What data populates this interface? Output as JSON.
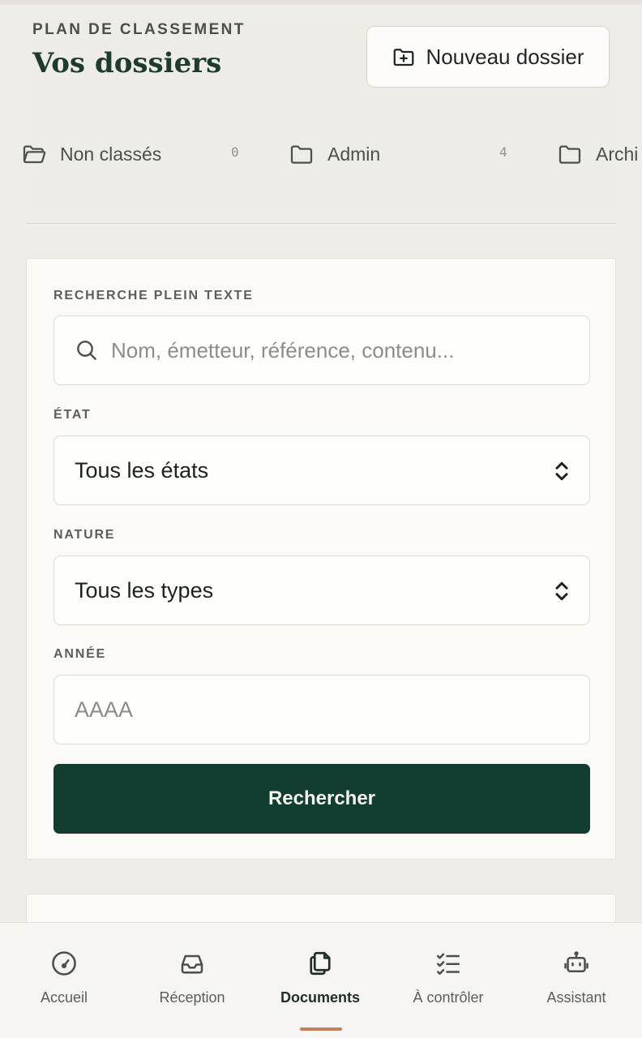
{
  "header": {
    "eyebrow": "PLAN DE CLASSEMENT",
    "title": "Vos dossiers",
    "new_folder_label": "Nouveau dossier"
  },
  "folders": [
    {
      "label": "Non classés",
      "count": "0",
      "icon": "folder-open-icon"
    },
    {
      "label": "Admin",
      "count": "4",
      "icon": "folder-icon"
    },
    {
      "label": "Archi",
      "count": "",
      "icon": "folder-icon"
    }
  ],
  "search": {
    "fulltext_label": "RECHERCHE PLEIN TEXTE",
    "fulltext_placeholder": "Nom, émetteur, référence, contenu...",
    "state_label": "ÉTAT",
    "state_value": "Tous les états",
    "nature_label": "NATURE",
    "nature_value": "Tous les types",
    "year_label": "ANNÉE",
    "year_placeholder": "AAAA",
    "submit_label": "Rechercher"
  },
  "nav": {
    "items": [
      {
        "label": "Accueil",
        "icon": "gauge-icon",
        "active": false
      },
      {
        "label": "Réception",
        "icon": "inbox-icon",
        "active": false
      },
      {
        "label": "Documents",
        "icon": "documents-icon",
        "active": true
      },
      {
        "label": "À contrôler",
        "icon": "checklist-icon",
        "active": false
      },
      {
        "label": "Assistant",
        "icon": "robot-icon",
        "active": false
      }
    ]
  },
  "colors": {
    "primary": "#143d31",
    "background": "#efede8",
    "card": "#fbfaf7",
    "accent": "#c4805e"
  }
}
